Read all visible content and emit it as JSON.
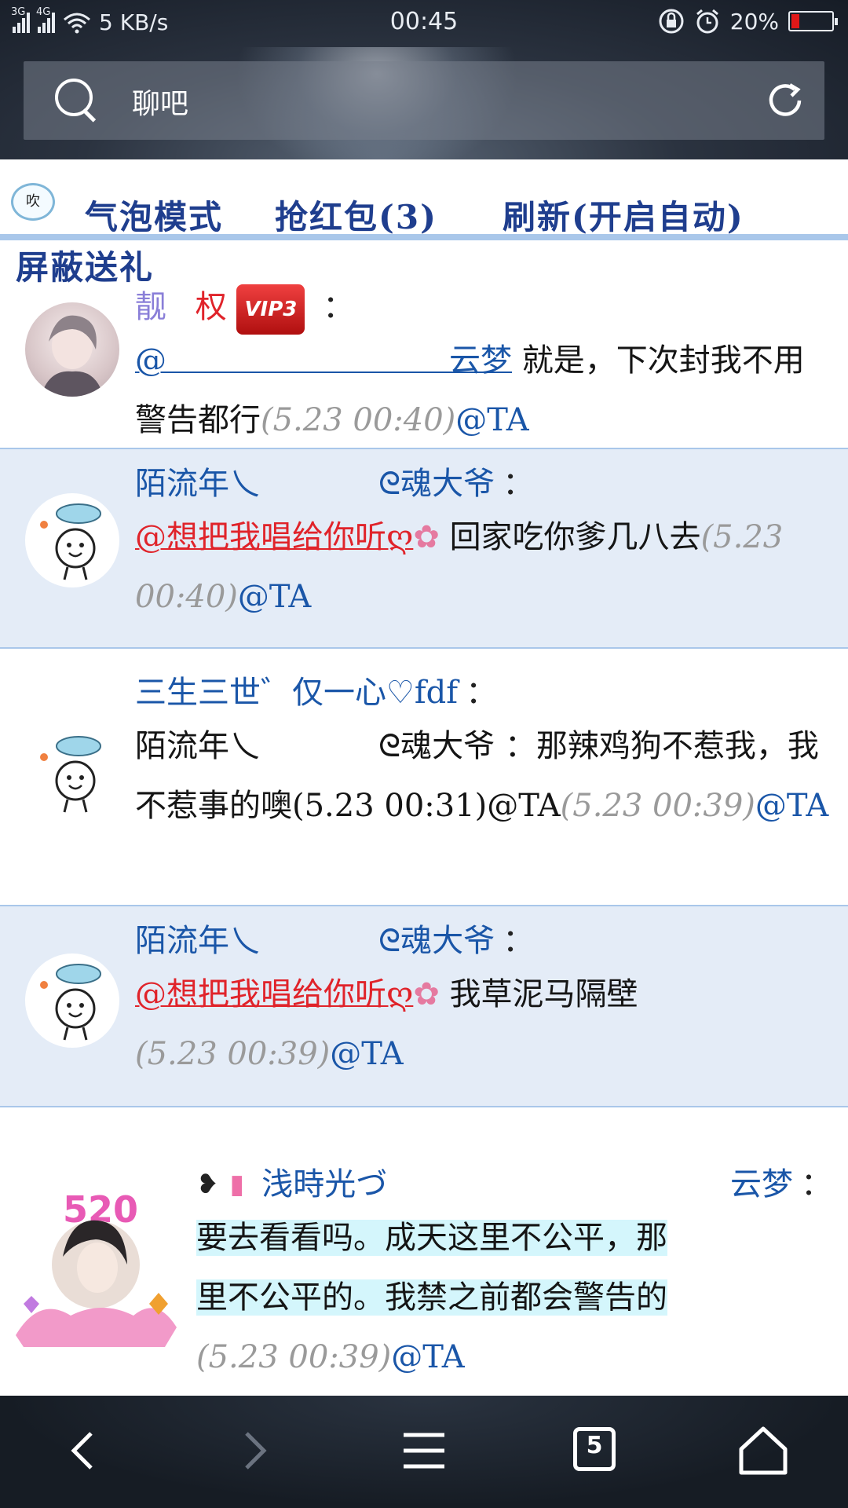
{
  "status_bar": {
    "net1": "3G",
    "net2": "4G",
    "speed": "5 KB/s",
    "time": "00:45",
    "battery": "20%",
    "battery_level": 0.2
  },
  "search": {
    "text": "聊吧"
  },
  "toolbar": {
    "bubble_icon_label": "吹",
    "bubble_mode": "气泡模式",
    "grab_red_packet": "抢红包(3)",
    "refresh": "刷新(开启自动)",
    "block_gifts": "屏蔽送礼"
  },
  "messages": [
    {
      "user_badge": "靓",
      "user_name": "权",
      "vip": "VIP3",
      "colon": "：",
      "mention": "@　　　　　　　　　云梦",
      "text": "就是，下次封我不用警告都行",
      "time": "(5.23 00:40)",
      "at": "@TA"
    },
    {
      "user_name": "陌流年乀",
      "user_suffix": "ᘓ魂大爷",
      "colon": "：",
      "mention": "@想把我唱给你听ღ",
      "text": "回家吃你爹几八去",
      "time": "(5.23 00:40)",
      "at": "@TA"
    },
    {
      "user_name": "三生三世゛仅一心♡fdf",
      "colon": "：",
      "quote_user": "陌流年乀",
      "quote_user_suffix": "ᘓ魂大爷",
      "text": "：那辣鸡狗不惹我，我不惹事的噢(5.23 00:31)@TA",
      "time": "(5.23 00:39)",
      "at": "@TA"
    },
    {
      "user_name": "陌流年乀",
      "user_suffix": "ᘓ魂大爷",
      "colon": "：",
      "mention": "@想把我唱给你听ღ",
      "text": "我草泥马隔壁",
      "time": "(5.23 00:39)",
      "at": "@TA"
    },
    {
      "user_name": "浅時光づ",
      "user_suffix": "云梦",
      "colon": "：",
      "avatar_badge": "520",
      "text_line1": "要去看看吗。成天这里不公平，那",
      "text_line2": "里不公平的。我禁之前都会警告的",
      "time": "(5.23 00:39)",
      "at": "@TA"
    }
  ],
  "nav": {
    "tab_count": "5"
  },
  "colors": {
    "accent": "#1a56a8",
    "mention_red": "#e0232a",
    "row_alt_bg": "#e4ecf7",
    "divider": "#a9c7ea",
    "timestamp": "#9a9a9a"
  }
}
